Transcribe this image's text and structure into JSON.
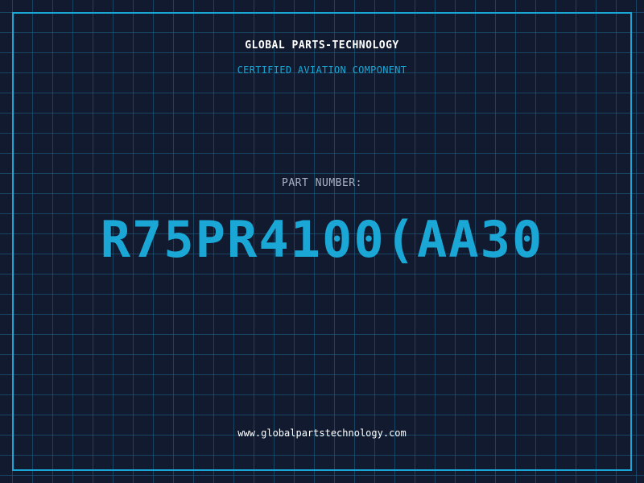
{
  "header": {
    "company_name": "GLOBAL PARTS-TECHNOLOGY",
    "certification": "CERTIFIED AVIATION COMPONENT"
  },
  "part": {
    "label": "PART NUMBER:",
    "number": "R75PR4100(AA30"
  },
  "footer": {
    "website": "www.globalpartstechnology.com"
  },
  "colors": {
    "background": "#111a2e",
    "grid": "#1e648c",
    "accent": "#1aa7d6",
    "text_primary": "#ffffff",
    "text_secondary": "#a7b3c4"
  }
}
